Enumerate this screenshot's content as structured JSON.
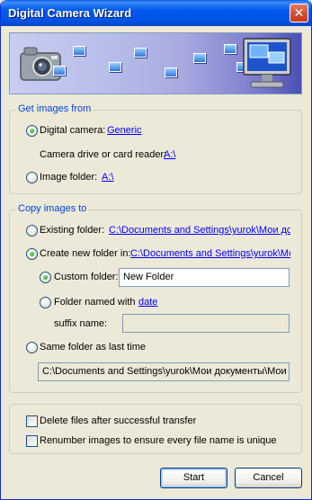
{
  "window": {
    "title": "Digital Camera Wizard"
  },
  "get_images": {
    "legend": "Get images from",
    "digital_camera_label": "Digital camera:",
    "digital_camera_value": "Generic",
    "card_reader_label": "Camera drive or card reader:",
    "card_reader_value": "A:\\",
    "image_folder_label": "Image folder:",
    "image_folder_value": "A:\\"
  },
  "copy_images": {
    "legend": "Copy images to",
    "existing_folder_label": "Existing folder:",
    "existing_folder_value": "C:\\Documents and Settings\\yurok\\Мои документы",
    "new_folder_label": "Create new folder in:",
    "new_folder_value": "C:\\Documents and Settings\\yurok\\Мои документы",
    "custom_folder_label": "Custom folder:",
    "custom_folder_value": "New Folder",
    "folder_named_label": "Folder named with",
    "folder_named_value": "date",
    "suffix_label": "suffix name:",
    "suffix_value": "",
    "same_folder_label": "Same folder as last time",
    "last_folder_value": "C:\\Documents and Settings\\yurok\\Мои документы\\Мои рисунки"
  },
  "options": {
    "delete_files_label": "Delete files after successful transfer",
    "renumber_label": "Renumber images to ensure every file name is unique"
  },
  "buttons": {
    "start": "Start",
    "cancel": "Cancel"
  },
  "state": {
    "source": "digital-camera",
    "destination": "create-new-folder",
    "new_folder_mode": "custom-folder",
    "delete_files": false,
    "renumber": false
  },
  "colors": {
    "title_bar": "#0058ee",
    "group_legend": "#0046d5",
    "link": "#0000ff",
    "face": "#ece9d8"
  },
  "icons": [
    "close-icon",
    "camera-icon",
    "monitor-icon",
    "image-card-icon"
  ]
}
